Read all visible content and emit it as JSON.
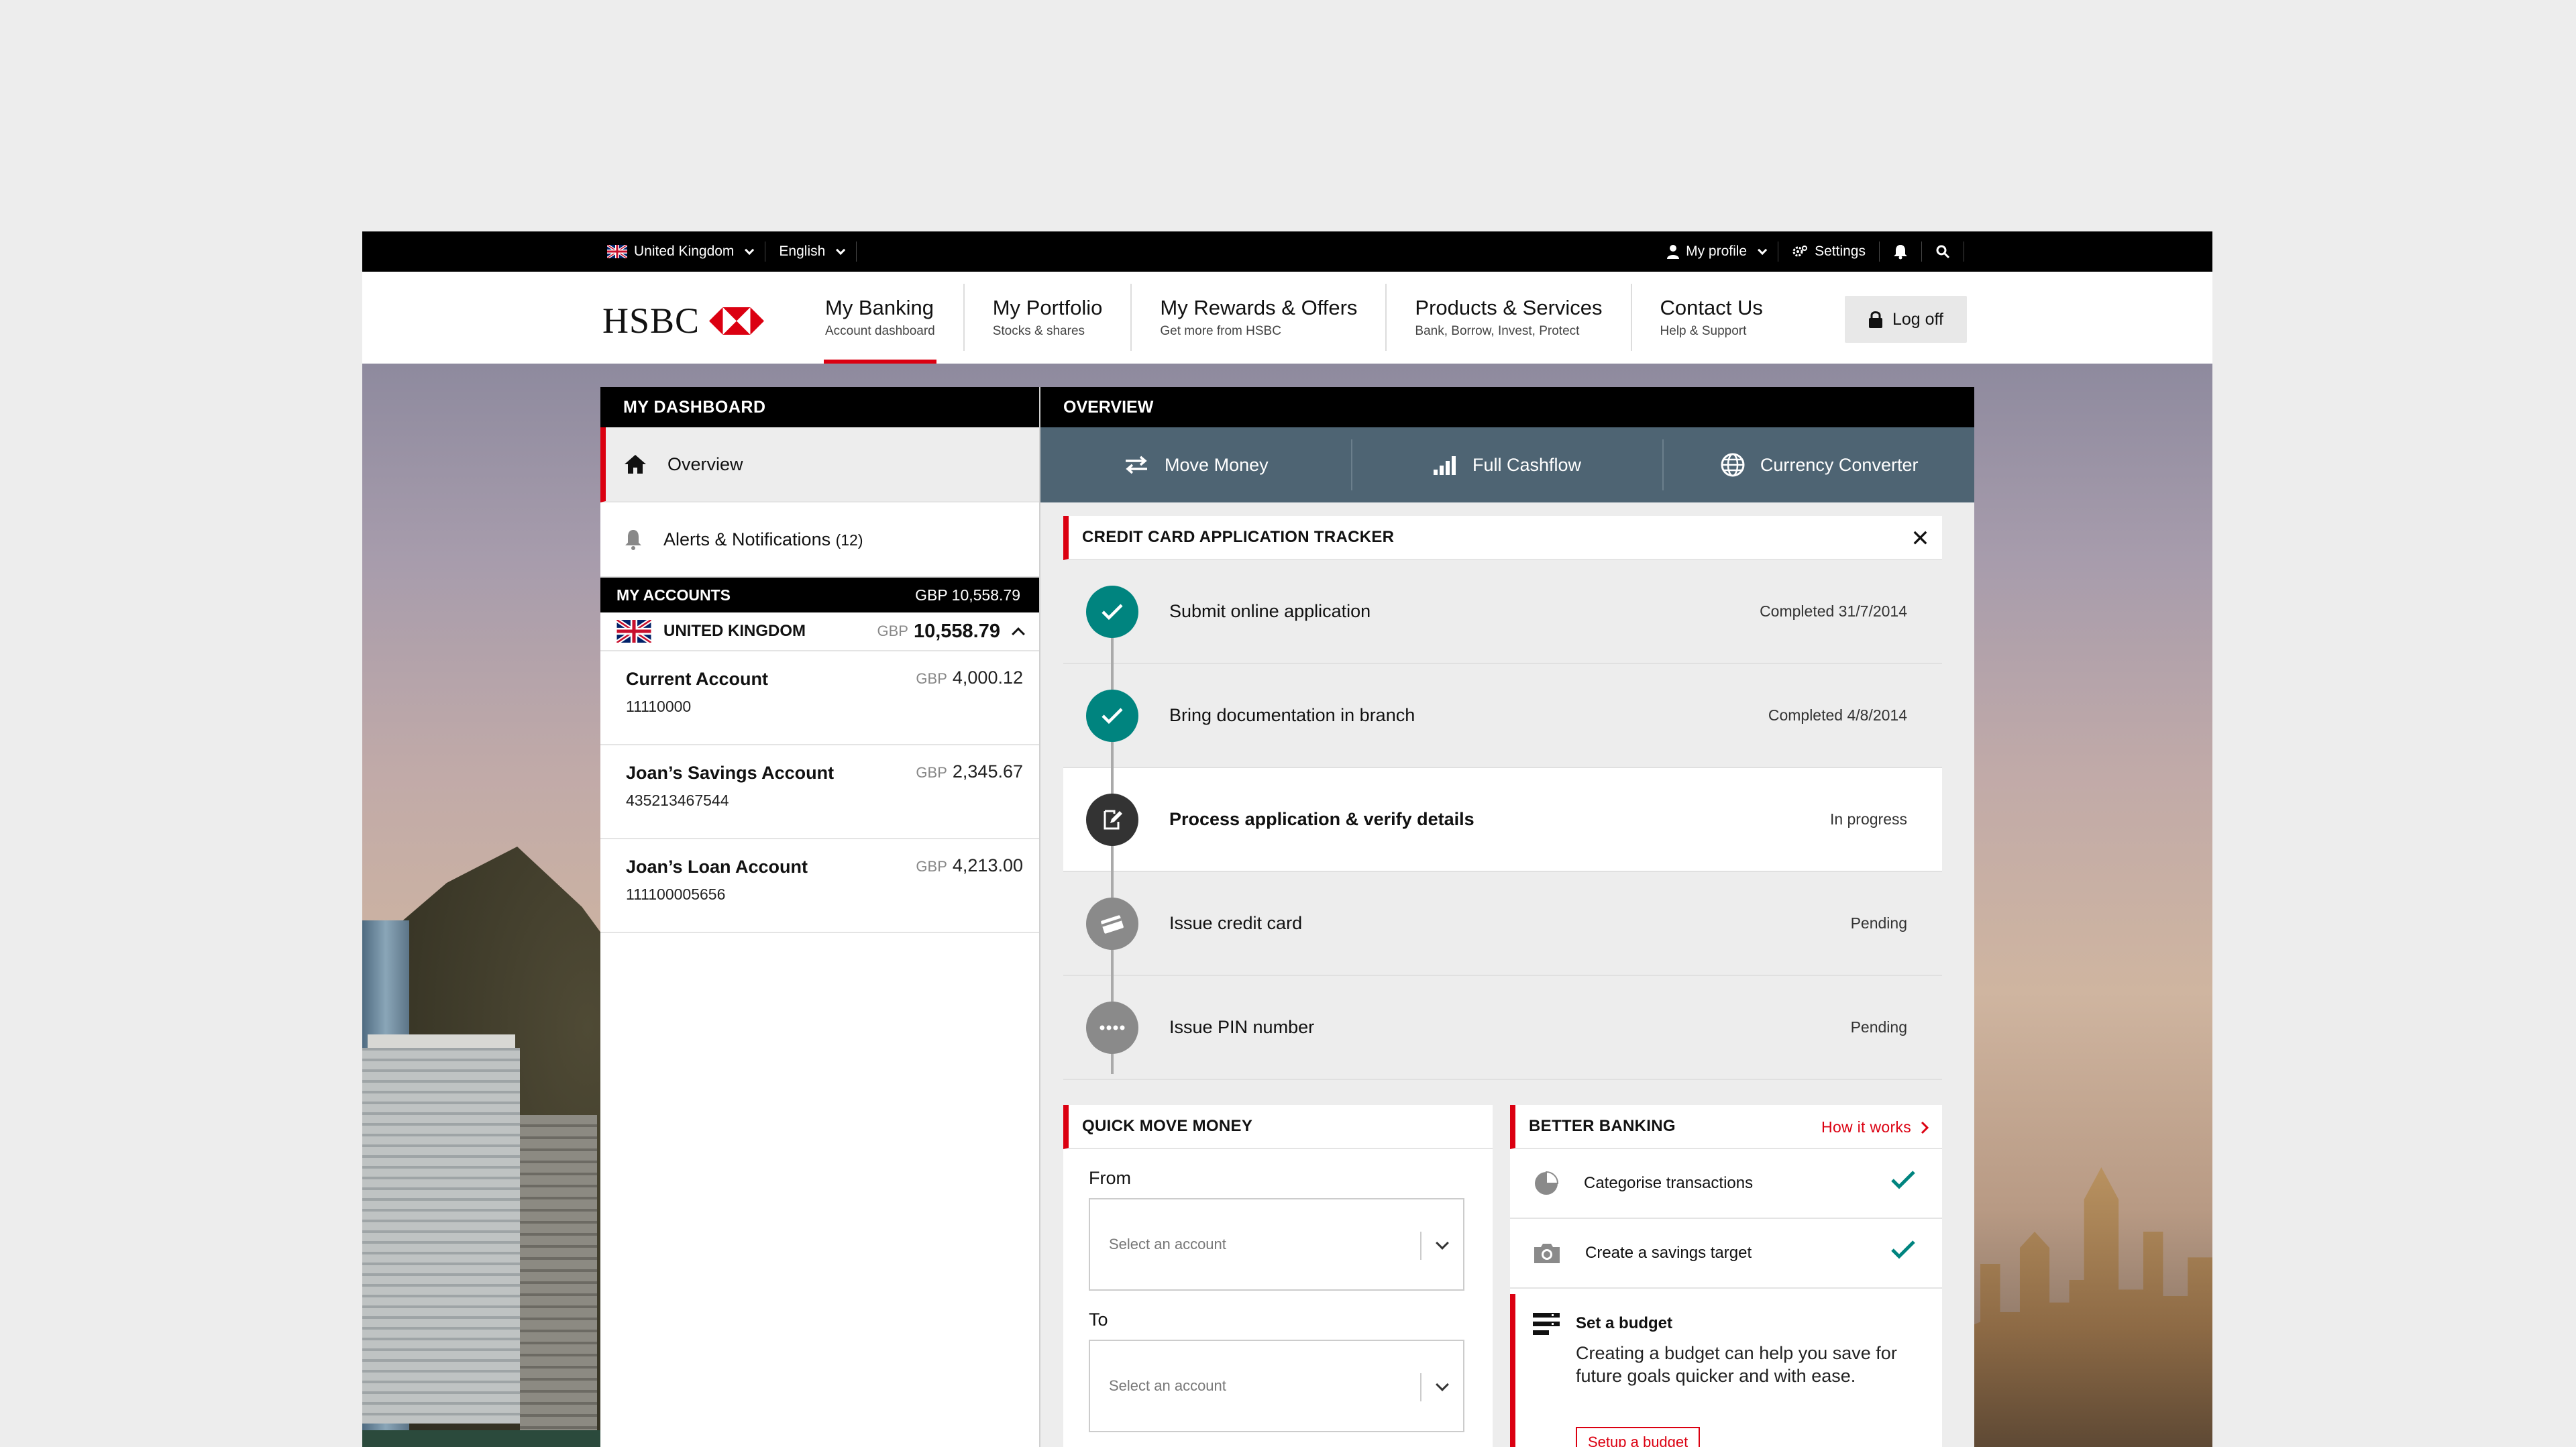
{
  "topbar": {
    "country": "United Kingdom",
    "language": "English",
    "profile": "My profile",
    "settings": "Settings"
  },
  "header": {
    "logo": "HSBC",
    "nav": [
      {
        "title": "My Banking",
        "subtitle": "Account dashboard"
      },
      {
        "title": "My Portfolio",
        "subtitle": "Stocks & shares"
      },
      {
        "title": "My Rewards & Offers",
        "subtitle": "Get more from HSBC"
      },
      {
        "title": "Products & Services",
        "subtitle": "Bank, Borrow, Invest, Protect"
      },
      {
        "title": "Contact Us",
        "subtitle": "Help & Support"
      }
    ],
    "logoff": "Log off"
  },
  "sidebar": {
    "title": "MY DASHBOARD",
    "overview": "Overview",
    "alerts": "Alerts & Notifications",
    "alerts_count": "(12)",
    "accounts_title": "MY ACCOUNTS",
    "accounts_total": "GBP 10,558.79",
    "region": "UNITED KINGDOM",
    "region_currency": "GBP",
    "region_amount": "10,558.79",
    "accounts": [
      {
        "name": "Current Account",
        "number": "11110000",
        "currency": "GBP",
        "amount": "4,000.12"
      },
      {
        "name": "Joan’s Savings Account",
        "number": "435213467544",
        "currency": "GBP",
        "amount": "2,345.67"
      },
      {
        "name": "Joan’s Loan Account",
        "number": "111100005656",
        "currency": "GBP",
        "amount": "4,213.00"
      }
    ]
  },
  "overview": {
    "title": "OVERVIEW",
    "actions": [
      "Move Money",
      "Full Cashflow",
      "Currency Converter"
    ]
  },
  "tracker": {
    "title": "CREDIT CARD APPLICATION TRACKER",
    "steps": [
      {
        "label": "Submit online application",
        "status": "Completed 31/7/2014"
      },
      {
        "label": "Bring documentation in branch",
        "status": "Completed 4/8/2014"
      },
      {
        "label": "Process application & verify details",
        "status": "In progress"
      },
      {
        "label": "Issue credit card",
        "status": "Pending"
      },
      {
        "label": "Issue PIN number",
        "status": "Pending"
      }
    ]
  },
  "quick_move": {
    "title": "QUICK MOVE MONEY",
    "from_label": "From",
    "to_label": "To",
    "placeholder": "Select an account"
  },
  "better_banking": {
    "title": "BETTER BANKING",
    "how": "How it works",
    "items": [
      "Categorise transactions",
      "Create a savings target"
    ],
    "budget_title": "Set a budget",
    "budget_desc": "Creating a budget can help you save for future goals quicker and with ease.",
    "budget_button": "Setup a budget"
  },
  "colors": {
    "brand_red": "#db0011",
    "teal": "#00847f",
    "slate": "#4e6473"
  }
}
